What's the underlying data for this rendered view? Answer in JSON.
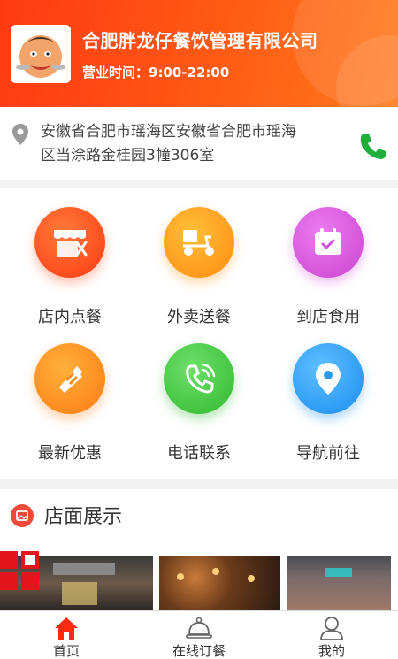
{
  "header": {
    "shop_name": "合肥胖龙仔餐饮管理有限公司",
    "hours": "营业时间：9:00-22:00",
    "logo_icon": "chef-avatar-logo",
    "gradient_colors": [
      "#ff3a12",
      "#ff7a1e"
    ]
  },
  "address": {
    "icon": "location-pin-icon",
    "line1": "安徽省合肥市瑶海区安徽省合肥市瑶海",
    "line2": "区当涂路金桂园3幢306室",
    "phone_icon": "phone-icon",
    "phone_color": "#1fae3c"
  },
  "menu": {
    "items": [
      {
        "label": "店内点餐",
        "icon": "storefront-icon",
        "color": "#ff4a1c"
      },
      {
        "label": "外卖送餐",
        "icon": "scooter-icon",
        "color": "#ff9a10"
      },
      {
        "label": "到店食用",
        "icon": "calendar-icon",
        "color": "#d94fd8"
      },
      {
        "label": "最新优惠",
        "icon": "coupon-icon",
        "color": "#ff8a1a"
      },
      {
        "label": "电话联系",
        "icon": "phone-call-icon",
        "color": "#3cc23c"
      },
      {
        "label": "导航前往",
        "icon": "navigation-pin-icon",
        "color": "#2a9bf5"
      }
    ]
  },
  "gallery": {
    "icon": "picture-icon",
    "title": "店面展示"
  },
  "tabbar": {
    "tabs": [
      {
        "label": "首页",
        "icon": "home-icon",
        "active": true,
        "color": "#ff2a10"
      },
      {
        "label": "在线订餐",
        "icon": "cloche-icon",
        "active": false
      },
      {
        "label": "我的",
        "icon": "user-icon",
        "active": false
      }
    ]
  }
}
